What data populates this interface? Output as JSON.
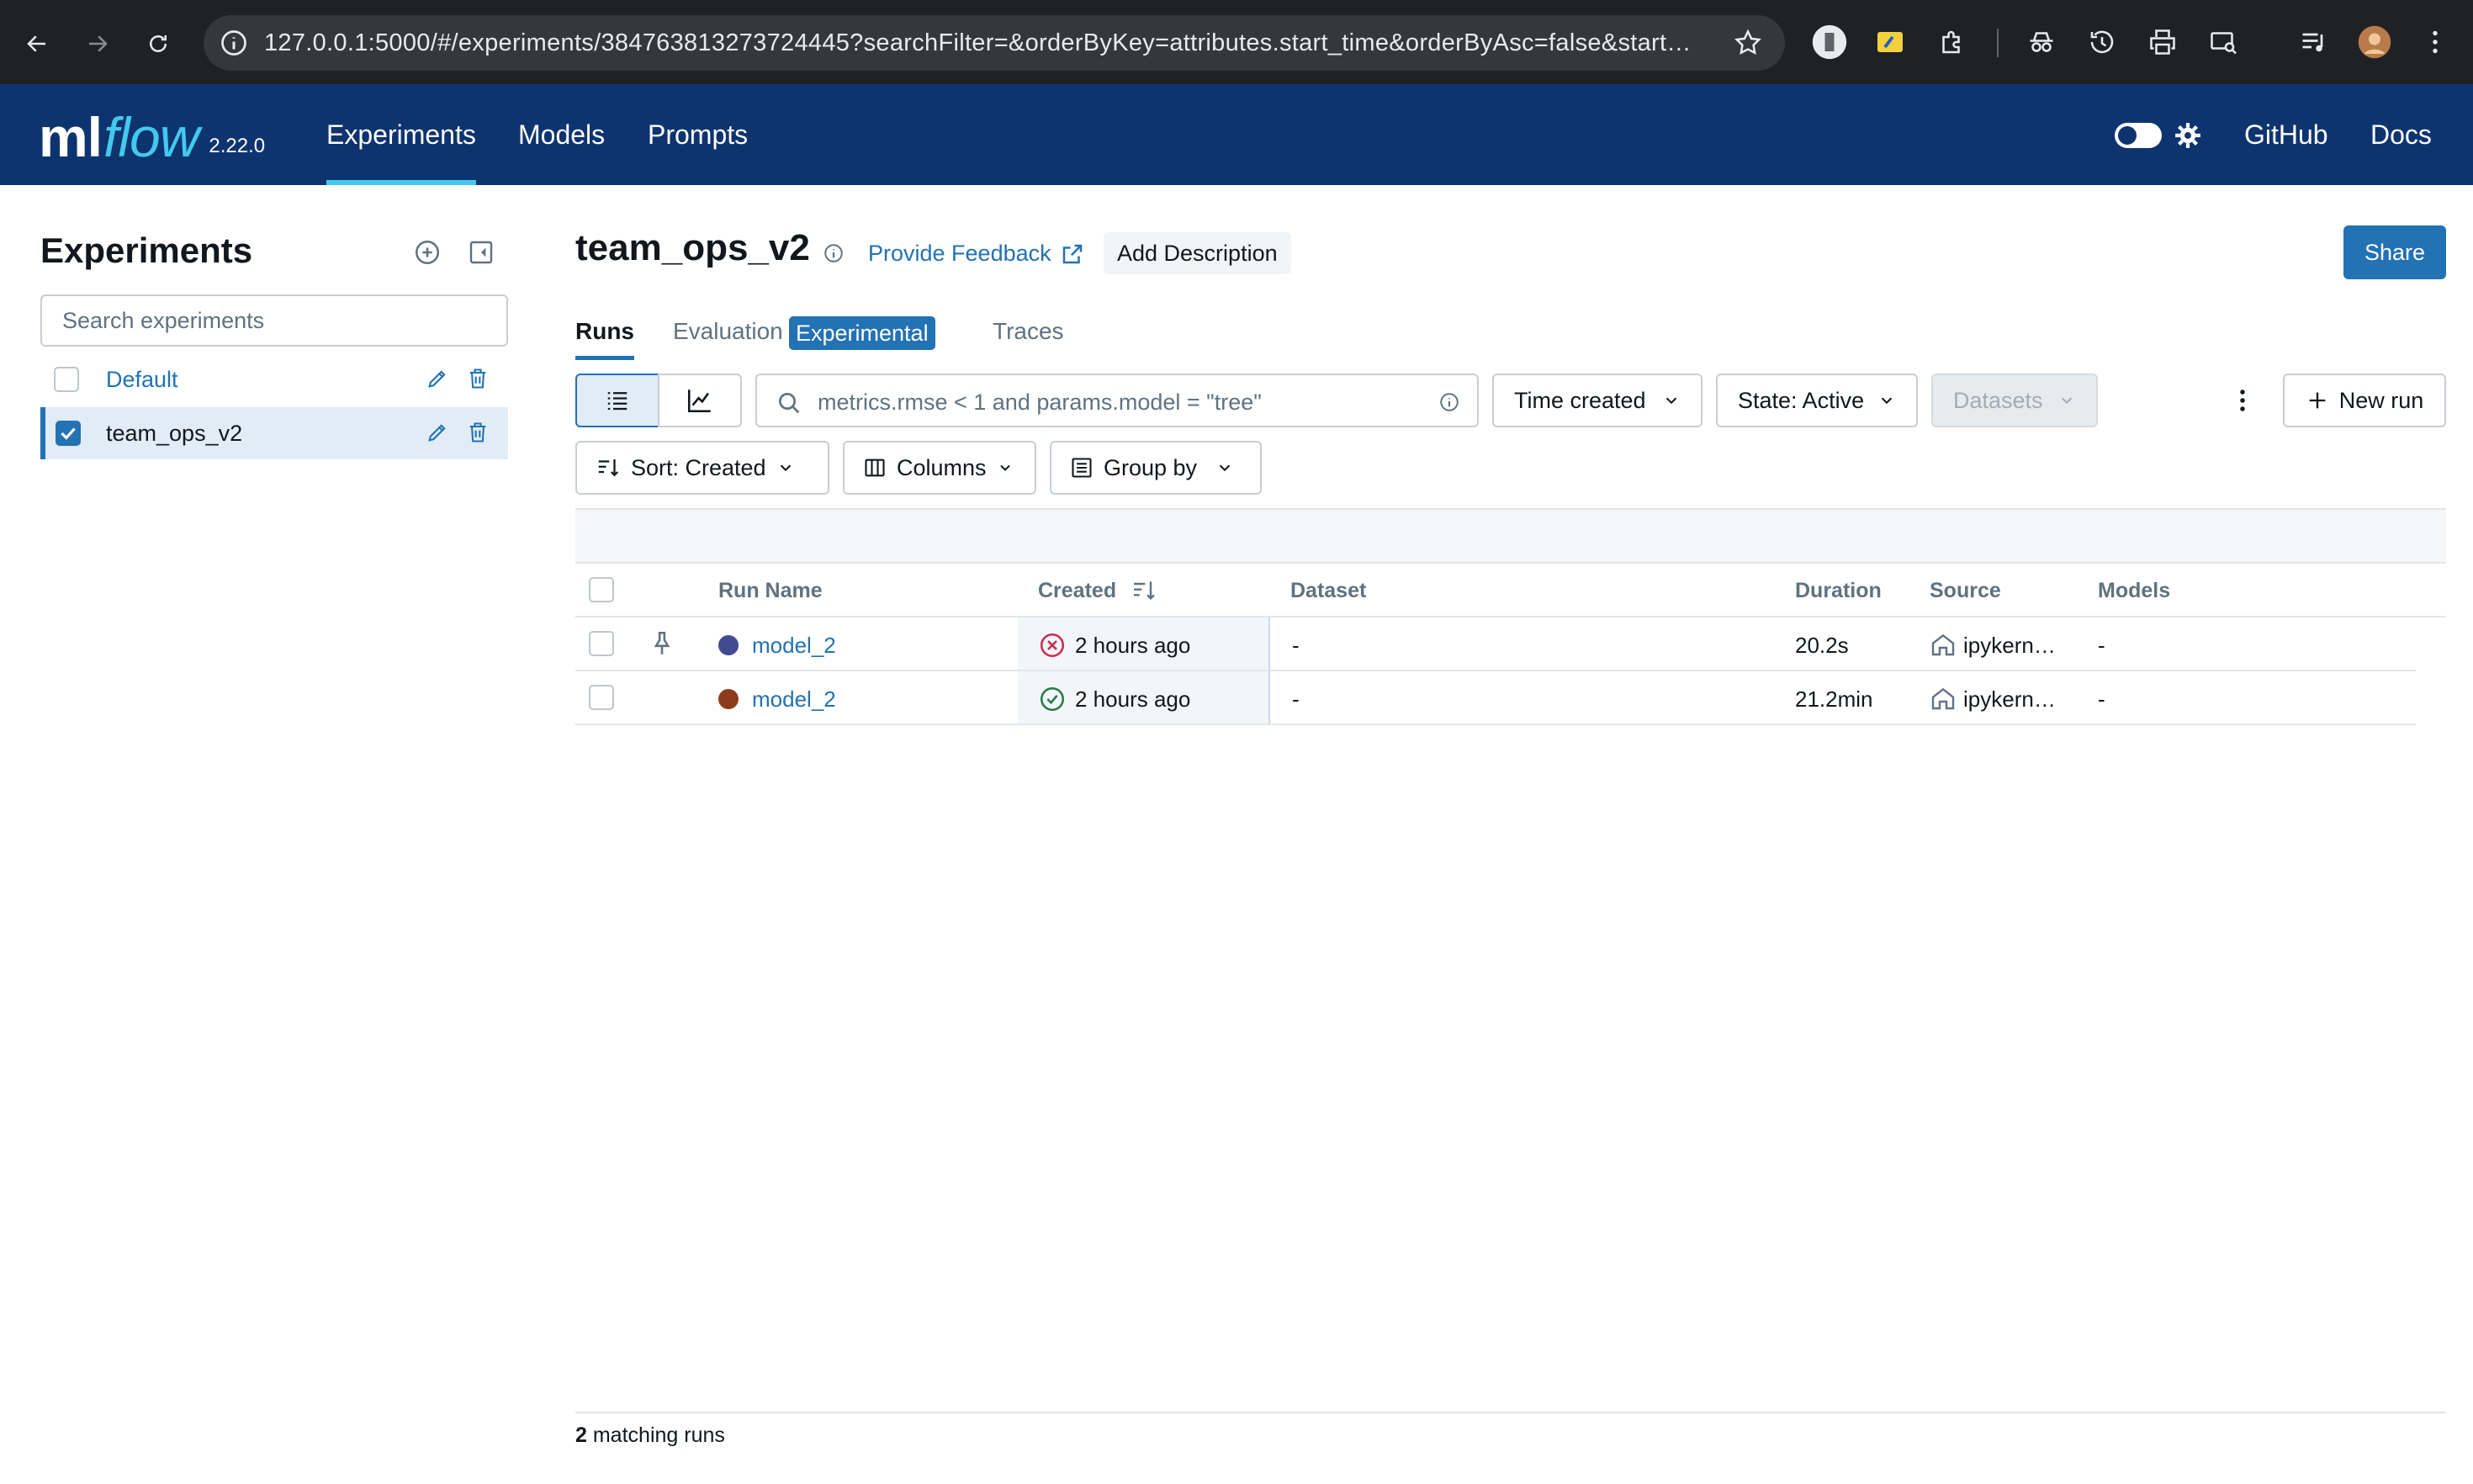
{
  "browser": {
    "url": "127.0.0.1:5000/#/experiments/384763813273724445?searchFilter=&orderByKey=attributes.start_time&orderByAsc=false&start…"
  },
  "header": {
    "logo_ml": "ml",
    "logo_flow": "flow",
    "version": "2.22.0",
    "nav": [
      "Experiments",
      "Models",
      "Prompts"
    ],
    "links": [
      "GitHub",
      "Docs"
    ]
  },
  "sidebar": {
    "title": "Experiments",
    "search_placeholder": "Search experiments",
    "experiments": [
      {
        "name": "Default",
        "checked": false
      },
      {
        "name": "team_ops_v2",
        "checked": true
      }
    ]
  },
  "experiment": {
    "name": "team_ops_v2",
    "feedback": "Provide Feedback",
    "add_description": "Add Description",
    "share": "Share"
  },
  "tabs": {
    "runs": "Runs",
    "evaluation": "Evaluation",
    "evaluation_badge": "Experimental",
    "traces": "Traces"
  },
  "toolbar": {
    "search_placeholder": "metrics.rmse < 1 and params.model = \"tree\"",
    "time_created": "Time created",
    "state": "State: Active",
    "datasets": "Datasets",
    "new_run": "New run",
    "sort": "Sort: Created",
    "columns": "Columns",
    "group_by": "Group by"
  },
  "table": {
    "headers": {
      "run_name": "Run Name",
      "created": "Created",
      "dataset": "Dataset",
      "duration": "Duration",
      "source": "Source",
      "models": "Models"
    },
    "rows": [
      {
        "run_name": "model_2",
        "color": "#434a93",
        "status": "failed",
        "created": "2 hours ago",
        "dataset": "-",
        "duration": "20.2s",
        "source": "ipykern…",
        "models": "-"
      },
      {
        "run_name": "model_2",
        "color": "#8d3b1b",
        "status": "finished",
        "created": "2 hours ago",
        "dataset": "-",
        "duration": "21.2min",
        "source": "ipykern…",
        "models": "-"
      }
    ],
    "footer_count": "2",
    "footer_text": "matching runs"
  },
  "colors": {
    "header_bg": "#0e3470",
    "accent": "#43c9ed",
    "primary": "#2272b4",
    "failed": "#c82d4c",
    "success": "#277c43"
  }
}
